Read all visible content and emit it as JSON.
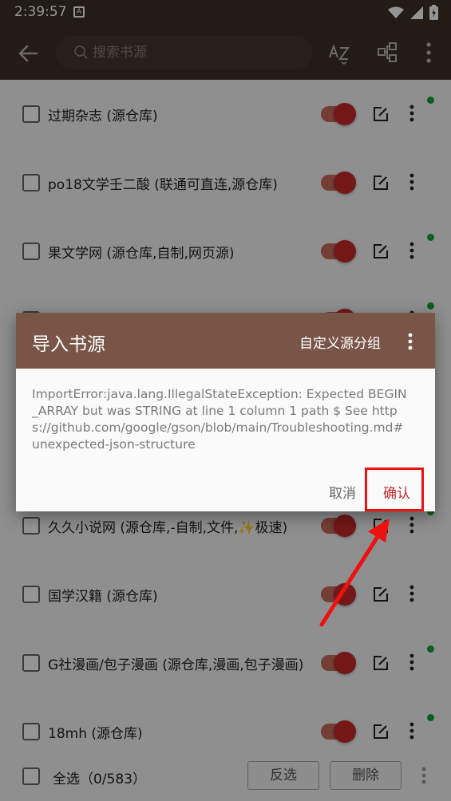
{
  "status": {
    "time": "2:39:57",
    "notif_glyph": "A"
  },
  "toolbar": {
    "search_placeholder": "搜索书源",
    "icons": [
      "back-arrow-icon",
      "sort-az-icon",
      "group-icon",
      "more-vert-icon"
    ]
  },
  "list": {
    "items": [
      {
        "name": "过期杂志 (源仓库)",
        "dot": true
      },
      {
        "name": "po18文学壬二酸 (联通可直连,源仓库)",
        "dot": false
      },
      {
        "name": "果文学网 (源仓库,自制,网页源)",
        "dot": true
      },
      {
        "name": "",
        "dot": true
      },
      {
        "name": "",
        "dot": false
      },
      {
        "name": "",
        "dot": false
      },
      {
        "name": "久久小说网 (源仓库,-自制,文件,✨极速)",
        "dot": true
      },
      {
        "name": "国学汉籍 (源仓库)",
        "dot": false
      },
      {
        "name": "G社漫画/包子漫画 (源仓库,漫画,包子漫画)",
        "dot": true
      },
      {
        "name": "18mh (源仓库)",
        "dot": true
      }
    ]
  },
  "bottom": {
    "select_all_label": "全选（0/583）",
    "invert_label": "反选",
    "delete_label": "删除"
  },
  "dialog": {
    "title": "导入书源",
    "custom_group_label": "自定义源分组",
    "message": "ImportError:java.lang.IllegalStateException: Expected BEGIN_ARRAY but was STRING at line 1 column 1 path $ See https://github.com/google/gson/blob/main/Troubleshooting.md#unexpected-json-structure",
    "cancel_label": "取消",
    "confirm_label": "确认"
  },
  "colors": {
    "toolbar_bg": "#3b2f26",
    "dialog_header": "#795548",
    "accent_red": "#c62828",
    "online_dot": "#19a33a",
    "annotation_red": "#ee1111"
  }
}
